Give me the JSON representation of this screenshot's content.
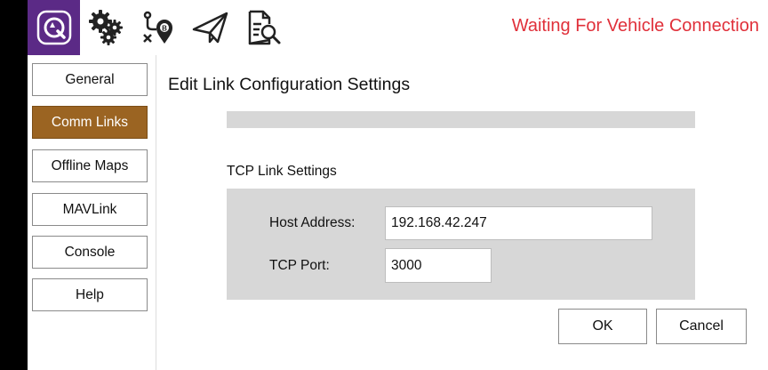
{
  "toolbar": {
    "icons": [
      "app-logo-icon",
      "settings-gears-icon",
      "plan-view-icon",
      "fly-view-icon",
      "analyze-view-icon"
    ],
    "status_text": "Waiting For Vehicle Connection",
    "status_color": "#e0303a",
    "logo_bg": "#5b2a86"
  },
  "sidebar": {
    "items": [
      {
        "label": "General",
        "active": false
      },
      {
        "label": "Comm Links",
        "active": true
      },
      {
        "label": "Offline Maps",
        "active": false
      },
      {
        "label": "MAVLink",
        "active": false
      },
      {
        "label": "Console",
        "active": false
      },
      {
        "label": "Help",
        "active": false
      }
    ],
    "active_color": "#9b6422"
  },
  "main": {
    "title": "Edit Link Configuration Settings",
    "section_title": "TCP Link Settings",
    "host_label": "Host Address:",
    "host_value": "192.168.42.247",
    "port_label": "TCP Port:",
    "port_value": "3000",
    "ok_label": "OK",
    "cancel_label": "Cancel"
  }
}
